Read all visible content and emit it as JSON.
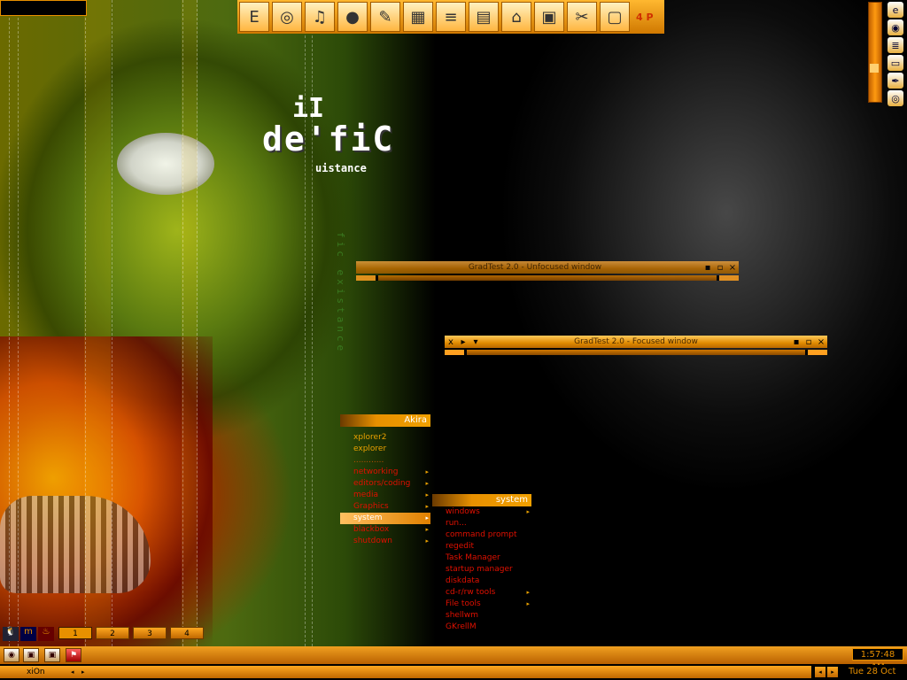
{
  "wallpaper": {
    "logo_top": "iI",
    "logo_title": "de'fiC",
    "logo_sub": "uistance",
    "logo_vertical": "fic existance"
  },
  "launcher": {
    "buttons": [
      {
        "icon": "explorer-e-icon",
        "glyph": "E"
      },
      {
        "icon": "cd-drive-icon",
        "glyph": "◎"
      },
      {
        "icon": "music-cd-icon",
        "glyph": "♫"
      },
      {
        "icon": "dvd-burner-icon",
        "glyph": "●"
      },
      {
        "icon": "tools-icon",
        "glyph": "✎"
      },
      {
        "icon": "windows-flag-icon",
        "glyph": "▦"
      },
      {
        "icon": "notepad-icon",
        "glyph": "≡"
      },
      {
        "icon": "ftp-folder-icon",
        "glyph": "▤"
      },
      {
        "icon": "network-drive-icon",
        "glyph": "⌂"
      },
      {
        "icon": "monitor-settings-icon",
        "glyph": "▣"
      },
      {
        "icon": "control-panel-icon",
        "glyph": "✂"
      },
      {
        "icon": "display-icon",
        "glyph": "▢"
      }
    ],
    "page_indicator": "4 P"
  },
  "tray": {
    "icons": [
      {
        "icon": "ie-globe-icon",
        "glyph": "e"
      },
      {
        "icon": "firefox-icon",
        "glyph": "◉"
      },
      {
        "icon": "list-app-icon",
        "glyph": "≣"
      },
      {
        "icon": "monitor-tray-icon",
        "glyph": "▭"
      },
      {
        "icon": "pen-tray-icon",
        "glyph": "✒"
      },
      {
        "icon": "cd-tray-icon",
        "glyph": "◎"
      }
    ]
  },
  "windows": {
    "unfocused": {
      "title": "GradTest 2.0 - Unfocused window"
    },
    "focused": {
      "title": "GradTest 2.0 - Focused window"
    }
  },
  "window_buttons": {
    "minimize": "▪",
    "maximize": "▫",
    "close": "×",
    "menu": "x",
    "shade": "▸",
    "stick": "▾"
  },
  "menu_main": {
    "title": "Akira",
    "items": [
      {
        "label": "xplorer2",
        "submenu": false
      },
      {
        "label": "explorer",
        "submenu": false
      },
      {
        "label": "............",
        "submenu": false
      },
      {
        "label": "networking",
        "submenu": true
      },
      {
        "label": "editors/coding",
        "submenu": true
      },
      {
        "label": "media",
        "submenu": true
      },
      {
        "label": "Graphics",
        "submenu": true
      },
      {
        "label": "system",
        "submenu": true
      },
      {
        "label": "blackbox",
        "submenu": true
      },
      {
        "label": "shutdown",
        "submenu": true
      }
    ],
    "selected": "system",
    "arrow": "▸"
  },
  "menu_system": {
    "title": "system",
    "items": [
      {
        "label": "windows",
        "submenu": true
      },
      {
        "label": "run...",
        "submenu": false
      },
      {
        "label": "command prompt",
        "submenu": false
      },
      {
        "label": "regedit",
        "submenu": false
      },
      {
        "label": "Task Manager",
        "submenu": false
      },
      {
        "label": "startup manager",
        "submenu": false
      },
      {
        "label": "diskdata",
        "submenu": false
      },
      {
        "label": "cd-r/rw tools",
        "submenu": true
      },
      {
        "label": "File tools",
        "submenu": true
      },
      {
        "label": "shellwm",
        "submenu": false
      },
      {
        "label": "GKrellM",
        "submenu": false
      }
    ]
  },
  "workspaces": {
    "labels": [
      "1",
      "2",
      "3",
      "4"
    ],
    "current": "1",
    "app_icons": [
      {
        "icon": "tux-icon",
        "glyph": "🐧"
      },
      {
        "icon": "mirc-icon",
        "glyph": "m"
      },
      {
        "icon": "fire-icon",
        "glyph": "♨"
      }
    ]
  },
  "taskbar": {
    "buttons": [
      {
        "icon": "gkrellm-icon",
        "glyph": "◉"
      },
      {
        "icon": "window-icon",
        "glyph": "▣"
      },
      {
        "icon": "window-icon-2",
        "glyph": "▣"
      },
      {
        "icon": "flag-icon",
        "glyph": "⚑"
      }
    ],
    "clock": "1:57:48 AM"
  },
  "bottombar": {
    "workspace_name": "xiOn",
    "prev_arrow": "◂",
    "next_arrow": "▸",
    "date": "Tue 28 Oct"
  },
  "colors": {
    "accent": "#e89000",
    "menu_text": "#e01000",
    "highlight": "#ffc060"
  }
}
